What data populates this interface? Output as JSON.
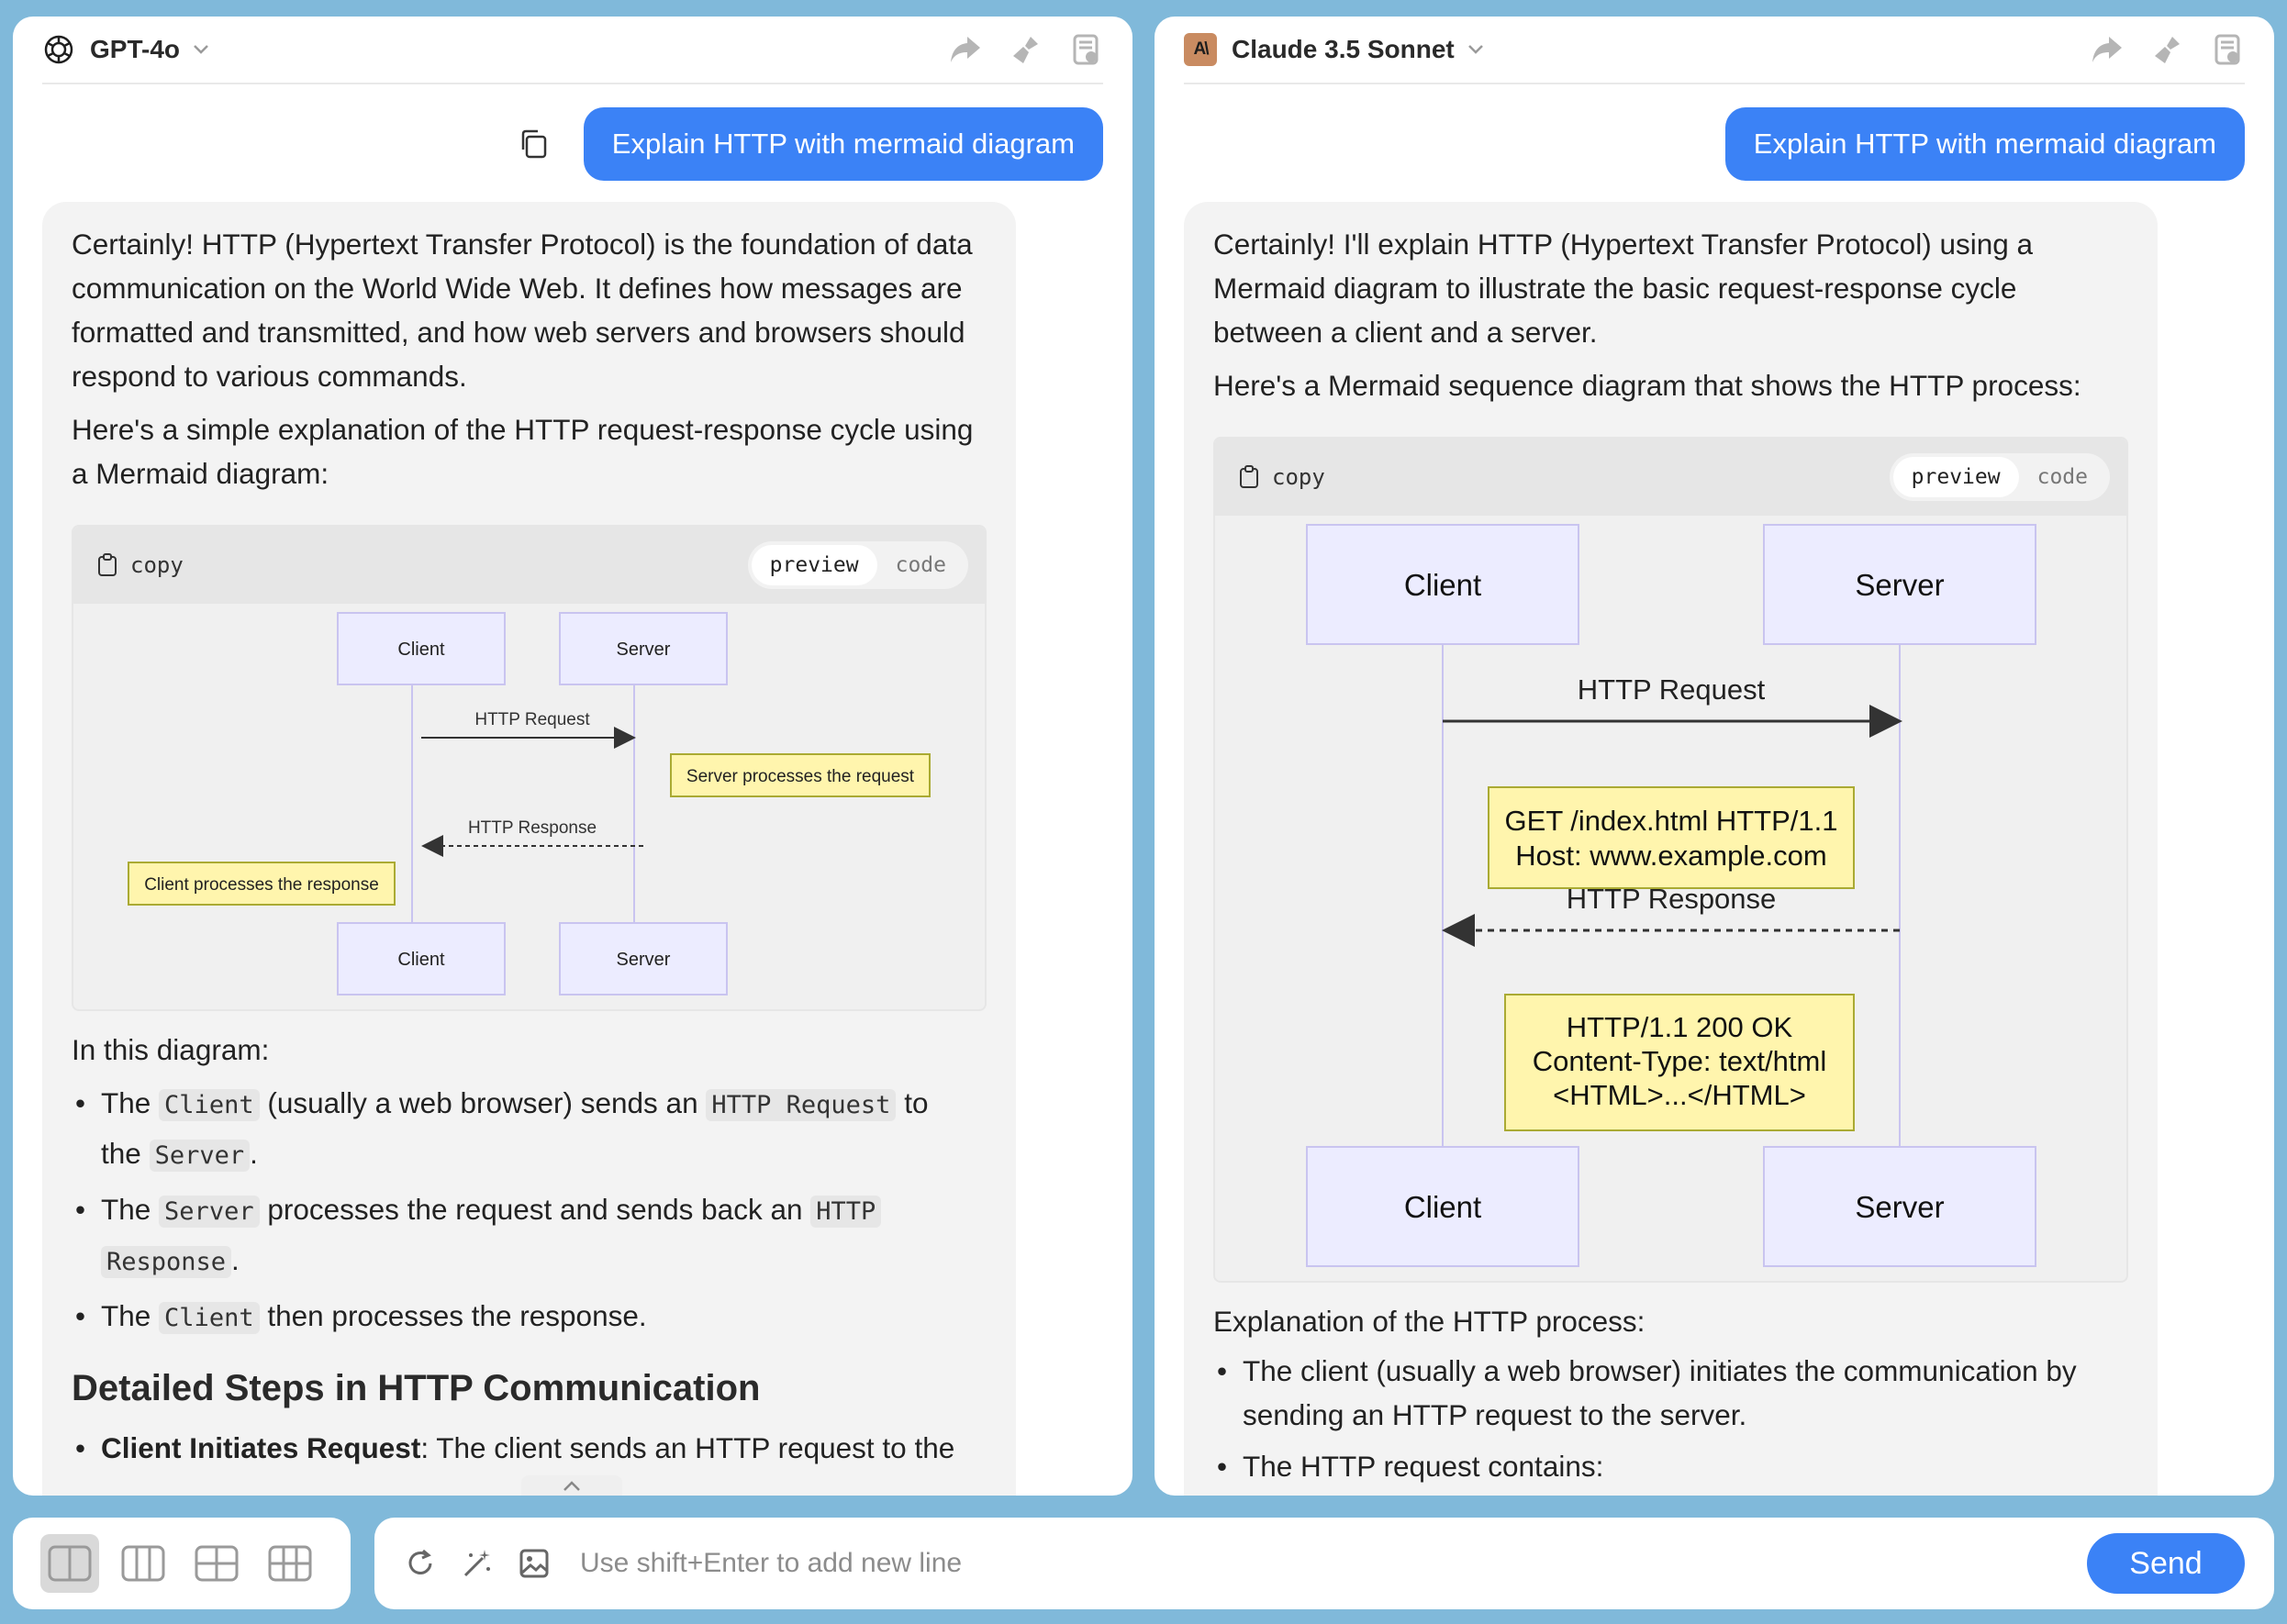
{
  "left_panel": {
    "model_name": "GPT-4o",
    "user_message": "Explain HTTP with mermaid diagram",
    "intro_1": "Certainly! HTTP (Hypertext Transfer Protocol) is the foundation of data communication on the World Wide Web. It defines how messages are formatted and transmitted, and how web servers and browsers should respond to various commands.",
    "intro_2": "Here's a simple explanation of the HTTP request-response cycle using a Mermaid diagram:",
    "card": {
      "copy_label": "copy",
      "preview_label": "preview",
      "code_label": "code"
    },
    "diagram": {
      "client": "Client",
      "server": "Server",
      "request": "HTTP Request",
      "response": "HTTP Response",
      "server_note": "Server processes the request",
      "client_note": "Client processes the response"
    },
    "after_intro": "In this diagram:",
    "bullets": {
      "b1_the": "The",
      "b1_code1": "Client",
      "b1_mid": "(usually a web browser) sends an",
      "b1_code2": "HTTP Request",
      "b1_to": "to",
      "b1_the2": "the",
      "b1_code3": "Server",
      "b1_end": ".",
      "b2_the": "The",
      "b2_code1": "Server",
      "b2_mid": "processes the request and sends back an",
      "b2_code2a": "HTTP",
      "b2_code2b": "Response",
      "b2_end": ".",
      "b3_the": "The",
      "b3_code1": "Client",
      "b3_end": "then processes the response."
    },
    "heading": "Detailed Steps in HTTP Communication",
    "step1_bold": "Client Initiates Request",
    "step1_text": ": The client sends an HTTP request to the"
  },
  "right_panel": {
    "model_name": "Claude 3.5 Sonnet",
    "model_logo": "A\\",
    "user_message": "Explain HTTP with mermaid diagram",
    "intro_1": "Certainly! I'll explain HTTP (Hypertext Transfer Protocol) using a Mermaid diagram to illustrate the basic request-response cycle between a client and a server.",
    "intro_2": "Here's a Mermaid sequence diagram that shows the HTTP process:",
    "card": {
      "copy_label": "copy",
      "preview_label": "preview",
      "code_label": "code"
    },
    "diagram": {
      "client": "Client",
      "server": "Server",
      "request": "HTTP Request",
      "response": "HTTP Response",
      "req_note_1": "GET /index.html HTTP/1.1",
      "req_note_2": "Host: www.example.com",
      "res_note_1": "HTTP/1.1 200 OK",
      "res_note_2": "Content-Type: text/html",
      "res_note_3": "<HTML>...</HTML>"
    },
    "explanation_title": "Explanation of the HTTP process:",
    "bullet_1": "The client (usually a web browser) initiates the communication by sending an HTTP request to the server.",
    "bullet_2": "The HTTP request contains:"
  },
  "input": {
    "placeholder": "Use shift+Enter to add new line",
    "send_label": "Send"
  },
  "colors": {
    "accent": "#3b82f6",
    "page_bg": "#80b9da",
    "participant_fill": "#ececff",
    "participant_stroke": "#c9c4f0",
    "note_fill": "#fff5ad",
    "note_stroke": "#aaaa33"
  }
}
